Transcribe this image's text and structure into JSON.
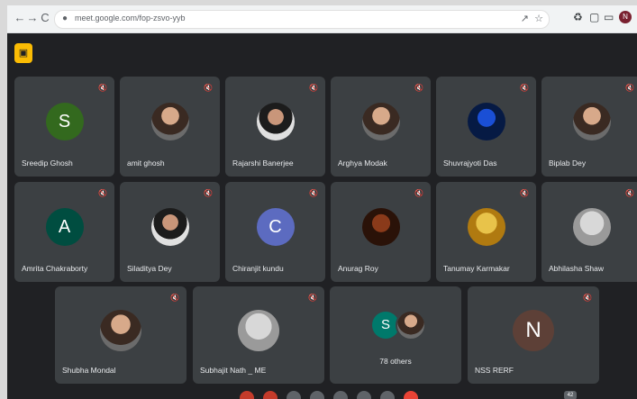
{
  "browser": {
    "back": "←",
    "forward": "→",
    "reload": "C",
    "url": "meet.google.com/fop-zsvo-yyb",
    "profile_initial": "N"
  },
  "meet": {
    "participants": [
      {
        "name": "Sreedip Ghosh",
        "initial": "S",
        "color": "#33691e"
      },
      {
        "name": "amit ghosh",
        "initial": "",
        "photo": "photo"
      },
      {
        "name": "Rajarshi Banerjee",
        "initial": "",
        "photo": "photo2"
      },
      {
        "name": "Arghya Modak",
        "initial": "",
        "photo": "photo"
      },
      {
        "name": "Shuvrajyoti Das",
        "initial": "",
        "photo": "photo3"
      },
      {
        "name": "Biplab Dey",
        "initial": "",
        "photo": "photo"
      },
      {
        "name": "Amrita Chakraborty",
        "initial": "A",
        "color": "#004d40"
      },
      {
        "name": "Siladitya Dey",
        "initial": "",
        "photo": "photo2"
      },
      {
        "name": "Chiranjit kundu",
        "initial": "C",
        "color": "#5c6bc0"
      },
      {
        "name": "Anurag Roy",
        "initial": "",
        "photo": "photo5"
      },
      {
        "name": "Tanumay Karmakar",
        "initial": "",
        "photo": "photo4"
      },
      {
        "name": "Abhilasha Shaw",
        "initial": "",
        "photo": "photo6"
      },
      {
        "name": "Shubha Mondal",
        "initial": "",
        "photo": "photo"
      },
      {
        "name": "Subhajit Nath _ ME",
        "initial": "",
        "photo": "photo6"
      },
      {
        "name": "NSS RERF",
        "initial": "N",
        "color": "#5d4037"
      }
    ],
    "others": {
      "label": "78 others",
      "initial": "S",
      "color": "#00796b"
    },
    "participant_count": "42"
  }
}
